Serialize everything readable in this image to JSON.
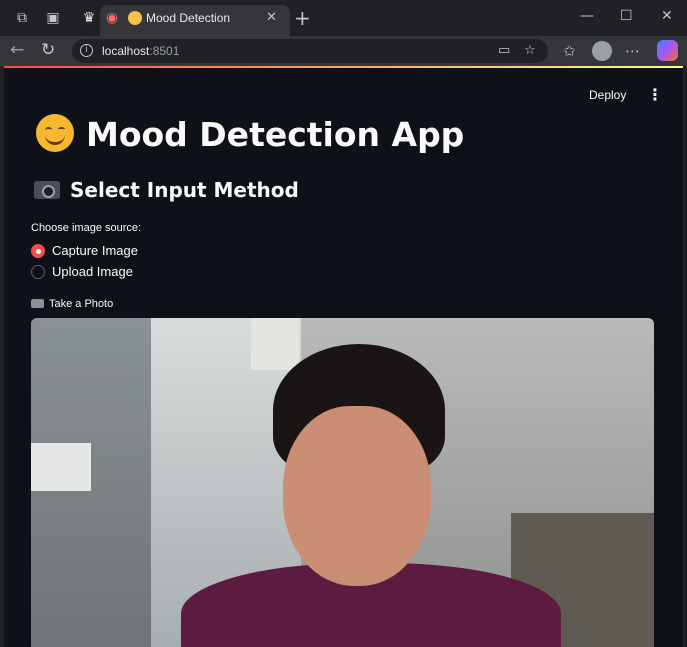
{
  "browser": {
    "tab_title": "Mood Detection",
    "url_host": "localhost",
    "url_port": ":8501"
  },
  "app": {
    "deploy_label": "Deploy",
    "title": "Mood Detection App",
    "section_heading": "Select Input Method",
    "radio_label": "Choose image source:",
    "radio_options": [
      {
        "label": "Capture Image",
        "selected": true
      },
      {
        "label": "Upload Image",
        "selected": false
      }
    ],
    "camera_label": "Take a Photo"
  },
  "colors": {
    "accent": "#ff4b4b",
    "page_background": "#0e1117",
    "text": "#fafafa"
  },
  "icons": {
    "title": "smiling-face-icon",
    "section": "camera-icon",
    "camera_label": "camera-icon"
  }
}
